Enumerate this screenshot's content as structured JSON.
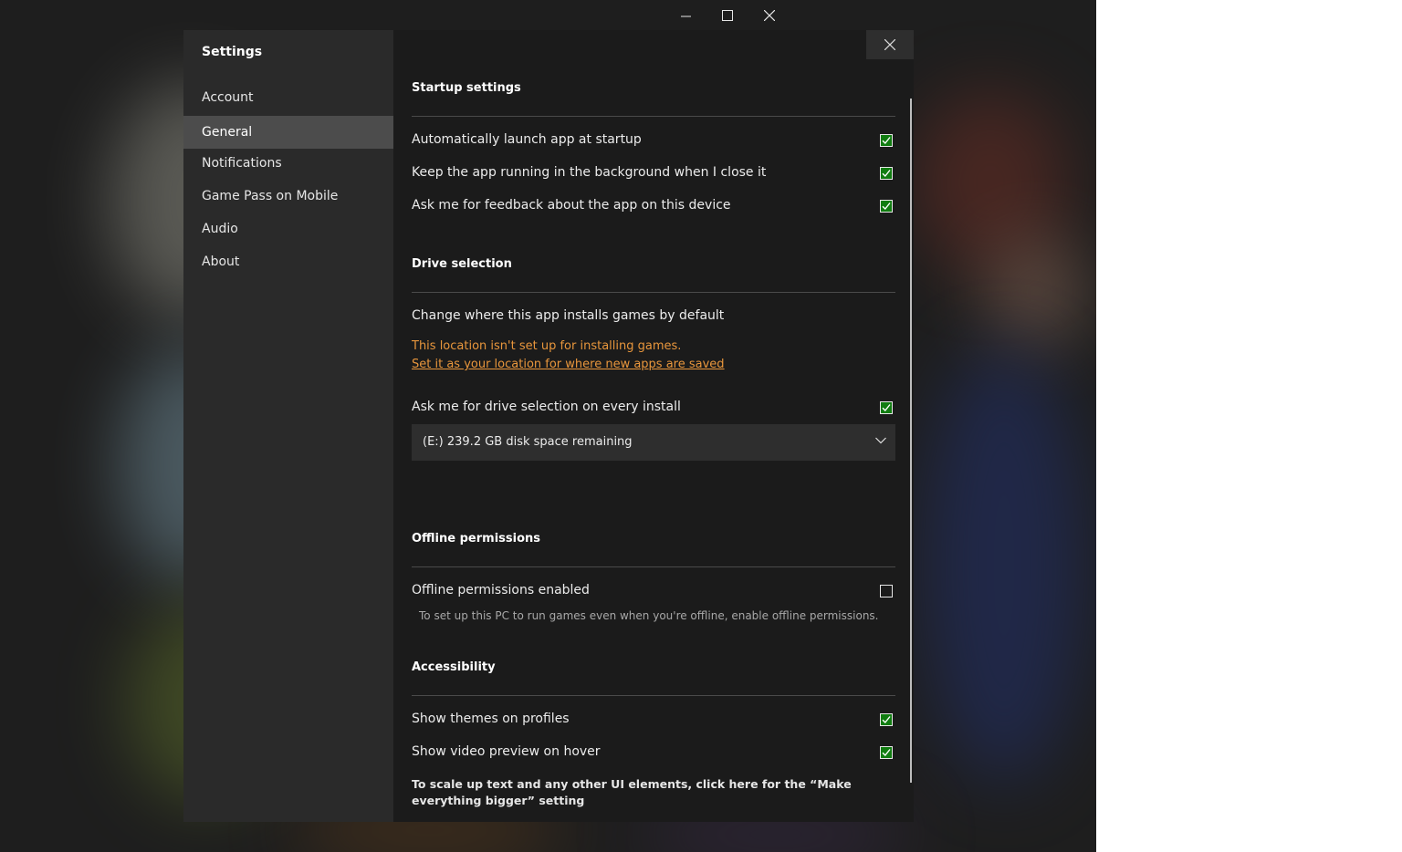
{
  "colors": {
    "accent_check": "#107c10",
    "warning": "#e8963c",
    "sidebar_bg": "#2a2a2a",
    "selected_nav_bg": "#4c4c4c",
    "dialog_bg": "#1b1b1b"
  },
  "window_controls": [
    "minimize-icon",
    "maximize-icon",
    "close-icon"
  ],
  "sidebar": {
    "title": "Settings",
    "items": [
      {
        "label": "Account"
      },
      {
        "label": "General",
        "selected": true
      },
      {
        "label": "Notifications"
      },
      {
        "label": "Game Pass on Mobile"
      },
      {
        "label": "Audio"
      },
      {
        "label": "About"
      }
    ]
  },
  "startup": {
    "heading": "Startup settings",
    "options": [
      {
        "label": "Automatically launch app at startup",
        "checked": true
      },
      {
        "label": "Keep the app running in the background when I close it",
        "checked": true
      },
      {
        "label": "Ask me for feedback about the app on this device",
        "checked": true
      }
    ]
  },
  "drive": {
    "heading": "Drive selection",
    "change_label": "Change where this app installs games by default",
    "warning": "This location isn't set up for installing games.",
    "warning_link": "Set it as your location for where new apps are saved",
    "ask_label": "Ask me for drive selection on every install",
    "ask_checked": true,
    "selected_drive": "(E:) 239.2 GB disk space remaining"
  },
  "offline": {
    "heading": "Offline permissions",
    "label": "Offline permissions enabled",
    "checked": false,
    "helper": "To set up this PC to run games even when you're offline, enable offline permissions."
  },
  "accessibility": {
    "heading": "Accessibility",
    "options": [
      {
        "label": "Show themes on profiles",
        "checked": true
      },
      {
        "label": "Show video preview on hover",
        "checked": true
      }
    ],
    "scale_note": "To scale up text and any other UI elements, click here for the “Make everything bigger” setting"
  }
}
